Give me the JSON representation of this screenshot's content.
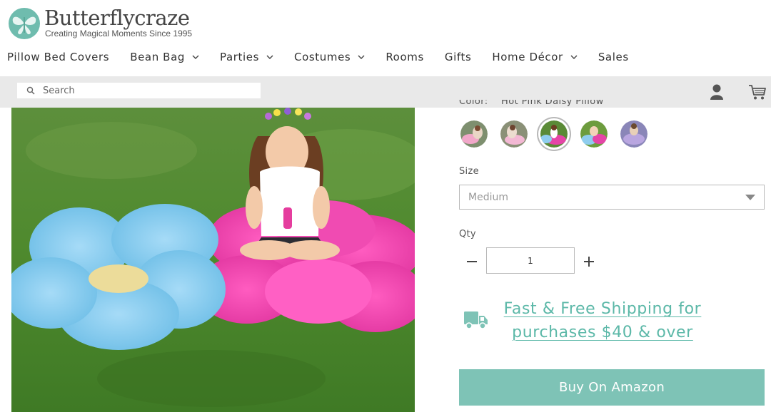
{
  "brand": {
    "name": "Butterflycraze",
    "tagline": "Creating Magical Moments Since 1995",
    "accent_color": "#7ec3b6",
    "link_color": "#5cb8a8"
  },
  "nav": {
    "items": [
      {
        "label": "Pillow Bed Covers",
        "has_dropdown": false
      },
      {
        "label": "Bean Bag",
        "has_dropdown": true
      },
      {
        "label": "Parties",
        "has_dropdown": true
      },
      {
        "label": "Costumes",
        "has_dropdown": true
      },
      {
        "label": "Rooms",
        "has_dropdown": false
      },
      {
        "label": "Gifts",
        "has_dropdown": false
      },
      {
        "label": "Home Décor",
        "has_dropdown": true
      },
      {
        "label": "Sales",
        "has_dropdown": false
      }
    ]
  },
  "search": {
    "placeholder": "Search",
    "icon": "search-icon"
  },
  "header_icons": [
    "account-icon",
    "cart-icon"
  ],
  "product": {
    "color_label": "Color:",
    "color_value": "Hot Pink Daisy Pillow",
    "swatches": [
      {
        "name": "Swatch 1",
        "selected": false
      },
      {
        "name": "Swatch 2",
        "selected": false
      },
      {
        "name": "Swatch 3",
        "selected": true
      },
      {
        "name": "Swatch 4",
        "selected": false
      },
      {
        "name": "Swatch 5",
        "selected": false
      }
    ],
    "size_label": "Size",
    "size_value": "Medium",
    "qty_label": "Qty",
    "qty_value": "1"
  },
  "shipping": {
    "line1": "Fast & Free Shipping for",
    "line2": "purchases $40 & over",
    "icon": "truck-icon"
  },
  "buy_button": {
    "label": "Buy On Amazon"
  }
}
